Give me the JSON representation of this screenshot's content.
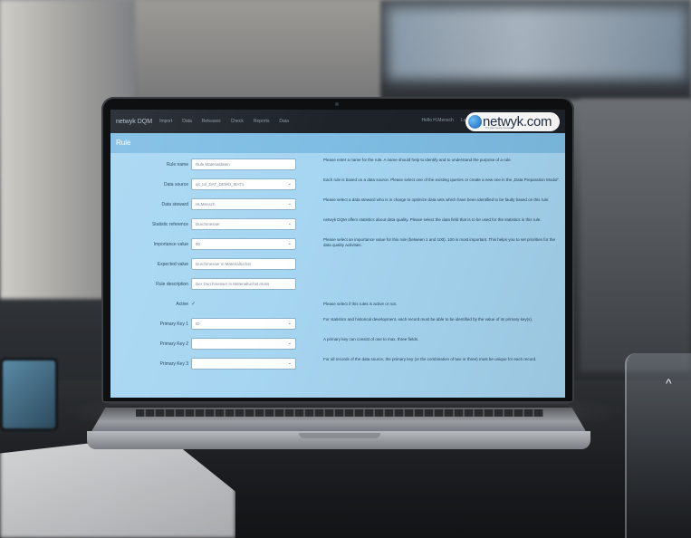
{
  "app": {
    "brand": "netwyk DQM",
    "nav": [
      "Import",
      "Data",
      "Releases",
      "Check",
      "Reports",
      "Data"
    ],
    "greeting": "Hello H.Mensch",
    "logout": "Log off",
    "logo_text": "netwyk.com",
    "logo_sub": "The Data Quality Network"
  },
  "page": {
    "title": "Rule"
  },
  "form": {
    "rows": [
      {
        "label": "Rule name",
        "type": "text",
        "value": "Rule Materialdaten",
        "help": "Please enter a name for the rule. A name should help to identify and to understand the purpose of a rule."
      },
      {
        "label": "Data source",
        "type": "select",
        "value": "qs_tol_DAT_DEMO_MAT1",
        "help": "Each rule is based on a data source. Please select one of the existing queries or create a new one in the „Data Preparation Modul“."
      },
      {
        "label": "Data steward",
        "type": "select",
        "value": "HLMensch",
        "help": "Please select a data steward who is in charge to optimize data sets which have been identified to be faulty based on this rule."
      },
      {
        "label": "Statistic reference",
        "type": "select",
        "value": "Durchmesser",
        "help": "netwyk DQM offers statistics about data quality. Please select the data field that is to be used for the statistics in this rule."
      },
      {
        "label": "Importance value",
        "type": "select",
        "value": "90",
        "help": "Please select an importance value for this rule (between 1 and 100). 100 is most important. This helps you to set priorities for the data quality activities."
      },
      {
        "label": "Expected value",
        "type": "text",
        "value": "Durchmesser in Materialtuchst",
        "help": ""
      },
      {
        "label": "Rule description",
        "type": "text",
        "value": "Der Durchmesser in Materialtuchst muss",
        "help": ""
      },
      {
        "label": "Active",
        "type": "check",
        "value": "✓",
        "help": "Please select if this rules is active or not."
      },
      {
        "label": "Primary Key 1",
        "type": "select",
        "value": "ID",
        "help": "For statistics and historical development, each record must be able to be identified by the value of its primary key(s)."
      },
      {
        "label": "Primary Key 2",
        "type": "select",
        "value": "",
        "help": "A primary key can consist of one to max. three fields."
      },
      {
        "label": "Primary Key 3",
        "type": "select",
        "value": "",
        "help": "For all records of the data source, the primary key (or the combination of two or three) must be unique for each record."
      }
    ]
  },
  "scene": {
    "glass_arrow": "^"
  }
}
